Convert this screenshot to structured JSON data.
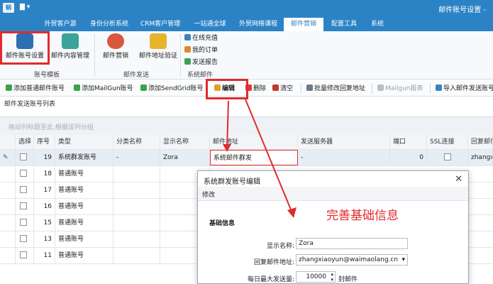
{
  "titlebar": {
    "logo": "蜗",
    "sys_menu": "▇ ▾",
    "window_title": "邮件账号设置 -"
  },
  "tabs": [
    "外贸客户源",
    "身份分析系统",
    "CRM客户管理",
    "一站通全球",
    "外贸网络课程",
    "邮件营销",
    "配置工具",
    "系统"
  ],
  "ribbon": {
    "buttons": [
      "邮件账号设置",
      "邮件内容管理",
      "邮件营销",
      "邮件地址验证"
    ],
    "small_items": [
      "在线充值",
      "我的订单",
      "发送报告"
    ],
    "groups": [
      "账号模板",
      "邮件发送",
      "系统邮件"
    ]
  },
  "toolbar": {
    "add_normal": "添加普通邮件账号",
    "add_mailgun": "添加MailGun账号",
    "add_sendgrid": "添加SendGrid账号",
    "edit": "编辑",
    "delete": "删除",
    "clear": "清空",
    "batch_modify": "批量修改回复地址",
    "mailgun_report": "Mailgun报表",
    "import": "导入邮件发送账号"
  },
  "section_label": "邮件发送账号列表",
  "group_hint": "拖动列标题至此,根据该列分组",
  "table": {
    "headers": [
      "选择",
      "序号",
      "类型",
      "分类名称",
      "显示名称",
      "邮件地址",
      "发送服务器",
      "端口",
      "SSL连接",
      "回复邮件"
    ],
    "rows": [
      {
        "index": "19",
        "type": "系统群发账号",
        "category": "-",
        "display": "Zora",
        "email": "系统邮件群发",
        "server": "-",
        "port": "0",
        "reply": "zhangx"
      },
      {
        "index": "18",
        "type": "普通账号"
      },
      {
        "index": "17",
        "type": "普通账号"
      },
      {
        "index": "16",
        "type": "普通账号"
      },
      {
        "index": "15",
        "type": "普通账号"
      },
      {
        "index": "13",
        "type": "普通账号"
      },
      {
        "index": "11",
        "type": "普通账号"
      }
    ]
  },
  "dialog": {
    "title": "系统群发账号编辑",
    "close": "✕",
    "tab": "修改",
    "section": "基础信息",
    "fields": {
      "display_label": "显示名称:",
      "display_value": "Zora",
      "reply_label": "回复邮件地址:",
      "reply_value": "zhangxiaoyun@waimaolang.cn",
      "daily_label": "每日最大发送量:",
      "daily_value": "10000",
      "daily_unit": "封邮件"
    }
  },
  "annotation": "完善基础信息",
  "colors": {
    "brand": "#2b83c6",
    "highlight": "#e02b2b"
  }
}
